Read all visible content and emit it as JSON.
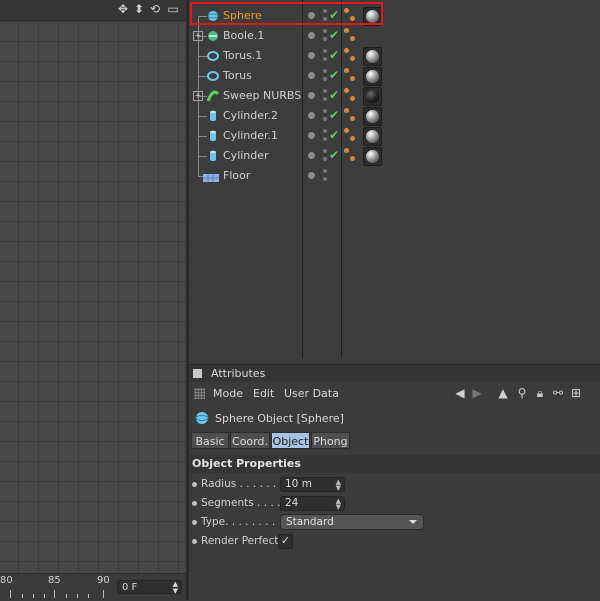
{
  "viewport": {
    "toolbar_icons": [
      "move-icon",
      "arrow-down-icon",
      "rotate-icon",
      "maximize-icon"
    ],
    "timeline": {
      "ticks": [
        "80",
        "85",
        "90"
      ],
      "frame_value": "0 F"
    }
  },
  "object_manager": {
    "objects": [
      {
        "name": "Sphere",
        "icon": "sphere-icon",
        "selected": true,
        "has_children": false,
        "check": true,
        "material": "gray"
      },
      {
        "name": "Boole.1",
        "icon": "boole-icon",
        "selected": false,
        "has_children": true,
        "check": true,
        "material": ""
      },
      {
        "name": "Torus.1",
        "icon": "torus-icon",
        "selected": false,
        "has_children": false,
        "check": true,
        "material": "gray"
      },
      {
        "name": "Torus",
        "icon": "torus-icon",
        "selected": false,
        "has_children": false,
        "check": true,
        "material": "gray"
      },
      {
        "name": "Sweep NURBS",
        "icon": "sweep-nurbs-icon",
        "selected": false,
        "has_children": true,
        "check": true,
        "material": "black"
      },
      {
        "name": "Cylinder.2",
        "icon": "cylinder-icon",
        "selected": false,
        "has_children": false,
        "check": true,
        "material": "gray"
      },
      {
        "name": "Cylinder.1",
        "icon": "cylinder-icon",
        "selected": false,
        "has_children": false,
        "check": true,
        "material": "gray"
      },
      {
        "name": "Cylinder",
        "icon": "cylinder-icon",
        "selected": false,
        "has_children": false,
        "check": true,
        "material": "gray"
      },
      {
        "name": "Floor",
        "icon": "floor-icon",
        "selected": false,
        "has_children": false,
        "check": false,
        "material": ""
      }
    ],
    "selected_color": "#f0a020",
    "highlight_color": "#e01818"
  },
  "attributes": {
    "title": "Attributes",
    "menu": [
      "Mode",
      "Edit",
      "User Data"
    ],
    "object_header": "Sphere Object [Sphere]",
    "tabs": [
      "Basic",
      "Coord.",
      "Object",
      "Phong"
    ],
    "active_tab": "Object",
    "section": "Object Properties",
    "properties": {
      "radius": {
        "label": "Radius . . . . . .",
        "value": "10 m"
      },
      "segments": {
        "label": "Segments . . . .",
        "value": "24"
      },
      "type": {
        "label": "Type. . . . . . . .",
        "value": "Standard"
      },
      "render_perfect": {
        "label": "Render Perfect",
        "checked": "✓"
      }
    },
    "active_tab_color": "#a8c4e2"
  }
}
